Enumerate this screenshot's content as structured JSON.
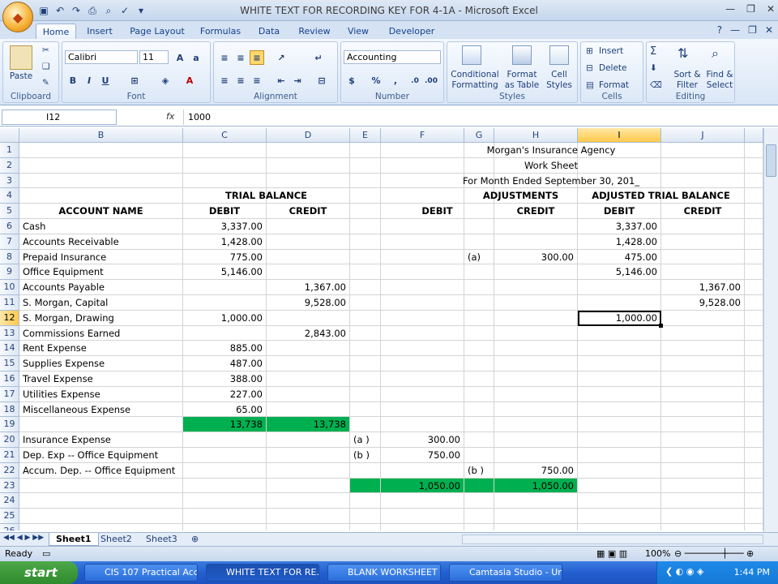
{
  "window": {
    "title": "WHITE TEXT FOR RECORDING KEY FOR 4-1A - Microsoft Excel"
  },
  "ribbon_tabs": [
    "Home",
    "Insert",
    "Page Layout",
    "Formulas",
    "Data",
    "Review",
    "View",
    "Developer"
  ],
  "ribbon": {
    "clipboard": {
      "label": "Clipboard",
      "paste": "Paste"
    },
    "font": {
      "label": "Font",
      "name": "Calibri",
      "size": "11"
    },
    "alignment": {
      "label": "Alignment"
    },
    "number": {
      "label": "Number",
      "format": "Accounting",
      "dollar": "$",
      "percent": "%",
      "comma": ","
    },
    "styles": {
      "label": "Styles",
      "conditional": "Conditional",
      "formatting": "Formatting",
      "format": "Format",
      "as_table": "as Table",
      "cell": "Cell",
      "cell_styles": "Styles"
    },
    "cells": {
      "label": "Cells",
      "insert": "Insert",
      "delete": "Delete",
      "format": "Format"
    },
    "editing": {
      "label": "Editing",
      "sort": "Sort &",
      "filter": "Filter",
      "find": "Find &",
      "select": "Select"
    }
  },
  "formula_bar": {
    "name_box": "I12",
    "value": "1000",
    "fx": "fx"
  },
  "columns": [
    "B",
    "C",
    "D",
    "E",
    "F",
    "G",
    "H",
    "I",
    "J"
  ],
  "rows_visible": [
    "1",
    "2",
    "3",
    "4",
    "5",
    "6",
    "7",
    "8",
    "9",
    "10",
    "11",
    "12",
    "13",
    "14",
    "15",
    "16",
    "17",
    "18",
    "19",
    "20",
    "21",
    "22",
    "23",
    "24",
    "25",
    "26"
  ],
  "sheet": {
    "header": {
      "company": "Morgan's Insurance Agency",
      "doc": "Work Sheet",
      "period": "For Month Ended September 30, 201_"
    },
    "section_headers": {
      "trial_balance": "TRIAL BALANCE",
      "adjustments": "ADJUSTMENTS",
      "adjusted_tb": "ADJUSTED TRIAL BALANCE"
    },
    "col_headers": {
      "account": "ACCOUNT NAME",
      "debit": "DEBIT",
      "credit": "CREDIT"
    },
    "rows": [
      {
        "r": "6",
        "name": "Cash",
        "tb_dr": "3,337.00",
        "tb_cr": "",
        "ea": "",
        "adj_dr": "",
        "ga": "",
        "adj_cr": "",
        "atb_dr": "3,337.00",
        "atb_cr": ""
      },
      {
        "r": "7",
        "name": "Accounts Receivable",
        "tb_dr": "1,428.00",
        "tb_cr": "",
        "ea": "",
        "adj_dr": "",
        "ga": "",
        "adj_cr": "",
        "atb_dr": "1,428.00",
        "atb_cr": ""
      },
      {
        "r": "8",
        "name": "Prepaid Insurance",
        "tb_dr": "775.00",
        "tb_cr": "",
        "ea": "",
        "adj_dr": "",
        "ga": "(a)",
        "adj_cr": "300.00",
        "atb_dr": "475.00",
        "atb_cr": ""
      },
      {
        "r": "9",
        "name": "Office Equipment",
        "tb_dr": "5,146.00",
        "tb_cr": "",
        "ea": "",
        "adj_dr": "",
        "ga": "",
        "adj_cr": "",
        "atb_dr": "5,146.00",
        "atb_cr": ""
      },
      {
        "r": "10",
        "name": "Accounts Payable",
        "tb_dr": "",
        "tb_cr": "1,367.00",
        "ea": "",
        "adj_dr": "",
        "ga": "",
        "adj_cr": "",
        "atb_dr": "",
        "atb_cr": "1,367.00"
      },
      {
        "r": "11",
        "name": "S. Morgan, Capital",
        "tb_dr": "",
        "tb_cr": "9,528.00",
        "ea": "",
        "adj_dr": "",
        "ga": "",
        "adj_cr": "",
        "atb_dr": "",
        "atb_cr": "9,528.00"
      },
      {
        "r": "12",
        "name": "S. Morgan, Drawing",
        "tb_dr": "1,000.00",
        "tb_cr": "",
        "ea": "",
        "adj_dr": "",
        "ga": "",
        "adj_cr": "",
        "atb_dr": "1,000.00",
        "atb_cr": ""
      },
      {
        "r": "13",
        "name": "Commissions Earned",
        "tb_dr": "",
        "tb_cr": "2,843.00",
        "ea": "",
        "adj_dr": "",
        "ga": "",
        "adj_cr": "",
        "atb_dr": "",
        "atb_cr": ""
      },
      {
        "r": "14",
        "name": "Rent Expense",
        "tb_dr": "885.00",
        "tb_cr": "",
        "ea": "",
        "adj_dr": "",
        "ga": "",
        "adj_cr": "",
        "atb_dr": "",
        "atb_cr": ""
      },
      {
        "r": "15",
        "name": "Supplies Expense",
        "tb_dr": "487.00",
        "tb_cr": "",
        "ea": "",
        "adj_dr": "",
        "ga": "",
        "adj_cr": "",
        "atb_dr": "",
        "atb_cr": ""
      },
      {
        "r": "16",
        "name": "Travel Expense",
        "tb_dr": "388.00",
        "tb_cr": "",
        "ea": "",
        "adj_dr": "",
        "ga": "",
        "adj_cr": "",
        "atb_dr": "",
        "atb_cr": ""
      },
      {
        "r": "17",
        "name": "Utilities Expense",
        "tb_dr": "227.00",
        "tb_cr": "",
        "ea": "",
        "adj_dr": "",
        "ga": "",
        "adj_cr": "",
        "atb_dr": "",
        "atb_cr": ""
      },
      {
        "r": "18",
        "name": "Miscellaneous Expense",
        "tb_dr": "65.00",
        "tb_cr": "",
        "ea": "",
        "adj_dr": "",
        "ga": "",
        "adj_cr": "",
        "atb_dr": "",
        "atb_cr": ""
      },
      {
        "r": "19",
        "name": "",
        "tb_dr": "13,738",
        "tb_cr": "13,738",
        "ea": "",
        "adj_dr": "",
        "ga": "",
        "adj_cr": "",
        "atb_dr": "",
        "atb_cr": "",
        "green_tb": true
      },
      {
        "r": "20",
        "name": "Insurance Expense",
        "tb_dr": "",
        "tb_cr": "",
        "ea": "(a )",
        "adj_dr": "300.00",
        "ga": "",
        "adj_cr": "",
        "atb_dr": "",
        "atb_cr": ""
      },
      {
        "r": "21",
        "name": "Dep. Exp -- Office Equipment",
        "tb_dr": "",
        "tb_cr": "",
        "ea": "(b )",
        "adj_dr": "750.00",
        "ga": "",
        "adj_cr": "",
        "atb_dr": "",
        "atb_cr": ""
      },
      {
        "r": "22",
        "name": "Accum. Dep. -- Office Equipment",
        "tb_dr": "",
        "tb_cr": "",
        "ea": "",
        "adj_dr": "",
        "ga": "(b )",
        "adj_cr": "750.00",
        "atb_dr": "",
        "atb_cr": ""
      },
      {
        "r": "23",
        "name": "",
        "tb_dr": "",
        "tb_cr": "",
        "ea": "",
        "adj_dr": "1,050.00",
        "ga": "",
        "adj_cr": "1,050.00",
        "atb_dr": "",
        "atb_cr": "",
        "green_adj": true
      },
      {
        "r": "24",
        "name": "",
        "tb_dr": "",
        "tb_cr": "",
        "ea": "",
        "adj_dr": "",
        "ga": "",
        "adj_cr": "",
        "atb_dr": "",
        "atb_cr": ""
      },
      {
        "r": "25",
        "name": "",
        "tb_dr": "",
        "tb_cr": "",
        "ea": "",
        "adj_dr": "",
        "ga": "",
        "adj_cr": "",
        "atb_dr": "",
        "atb_cr": ""
      }
    ]
  },
  "sheet_tabs": [
    "Sheet1",
    "Sheet2",
    "Sheet3"
  ],
  "status": {
    "ready": "Ready",
    "zoom": "100%"
  },
  "taskbar": {
    "start": "start",
    "items": [
      "CIS 107 Practical Acc...",
      "WHITE TEXT FOR RE...",
      "BLANK WORKSHEET",
      "Camtasia Studio - Unt..."
    ],
    "clock": "1:44 PM"
  },
  "colors": {
    "green": "#00b050",
    "accent": "#15428b"
  }
}
